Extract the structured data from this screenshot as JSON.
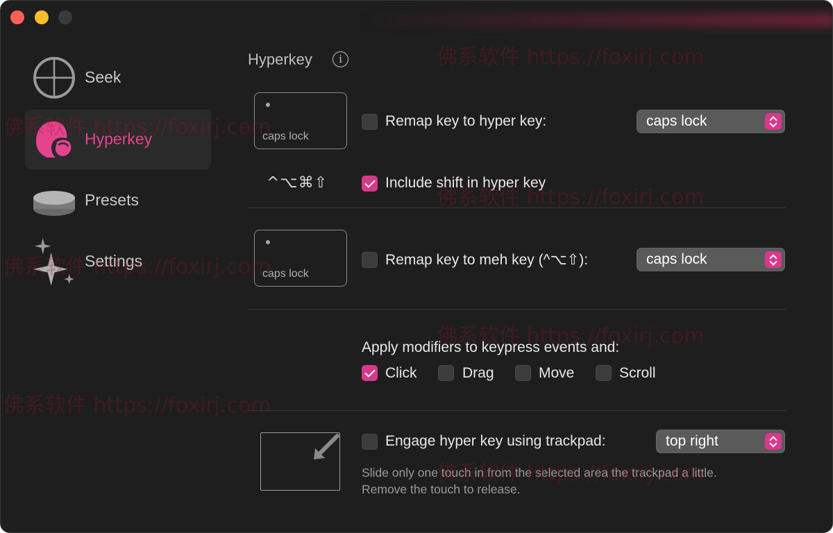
{
  "sidebar": {
    "items": [
      {
        "label": "Seek",
        "icon": "crosshair-icon"
      },
      {
        "label": "Hyperkey",
        "icon": "helmet-icon",
        "selected": true
      },
      {
        "label": "Presets",
        "icon": "stack-icon"
      },
      {
        "label": "Settings",
        "icon": "sparkles-icon"
      }
    ]
  },
  "main": {
    "title": "Hyperkey",
    "info_icon": "info-icon",
    "hyper": {
      "keycap_label": "caps lock",
      "checkbox_label": "Remap key to hyper key:",
      "checked": false,
      "popup_value": "caps lock",
      "modifier_symbols": "^⌥⌘⇧",
      "include_shift_label": "Include shift in hyper key",
      "include_shift_checked": true
    },
    "meh": {
      "keycap_label": "caps lock",
      "checkbox_label": "Remap key to meh key (^⌥⇧):",
      "checked": false,
      "popup_value": "caps lock"
    },
    "apply": {
      "heading": "Apply modifiers to keypress events and:",
      "options": [
        {
          "label": "Click",
          "checked": true
        },
        {
          "label": "Drag",
          "checked": false
        },
        {
          "label": "Move",
          "checked": false
        },
        {
          "label": "Scroll",
          "checked": false
        }
      ]
    },
    "trackpad": {
      "checkbox_label": "Engage hyper key using trackpad:",
      "checked": false,
      "popup_value": "top right",
      "hint_line1": "Slide only one touch in from the selected area the trackpad a little.",
      "hint_line2": "Remove the touch to release."
    }
  },
  "watermark": "佛系软件 https://foxirj.com",
  "colors": {
    "accent": "#d8388c",
    "accent_text": "#e6438f",
    "background": "#1e1e1e",
    "close": "#fe5f57",
    "minimize": "#febc2e"
  }
}
